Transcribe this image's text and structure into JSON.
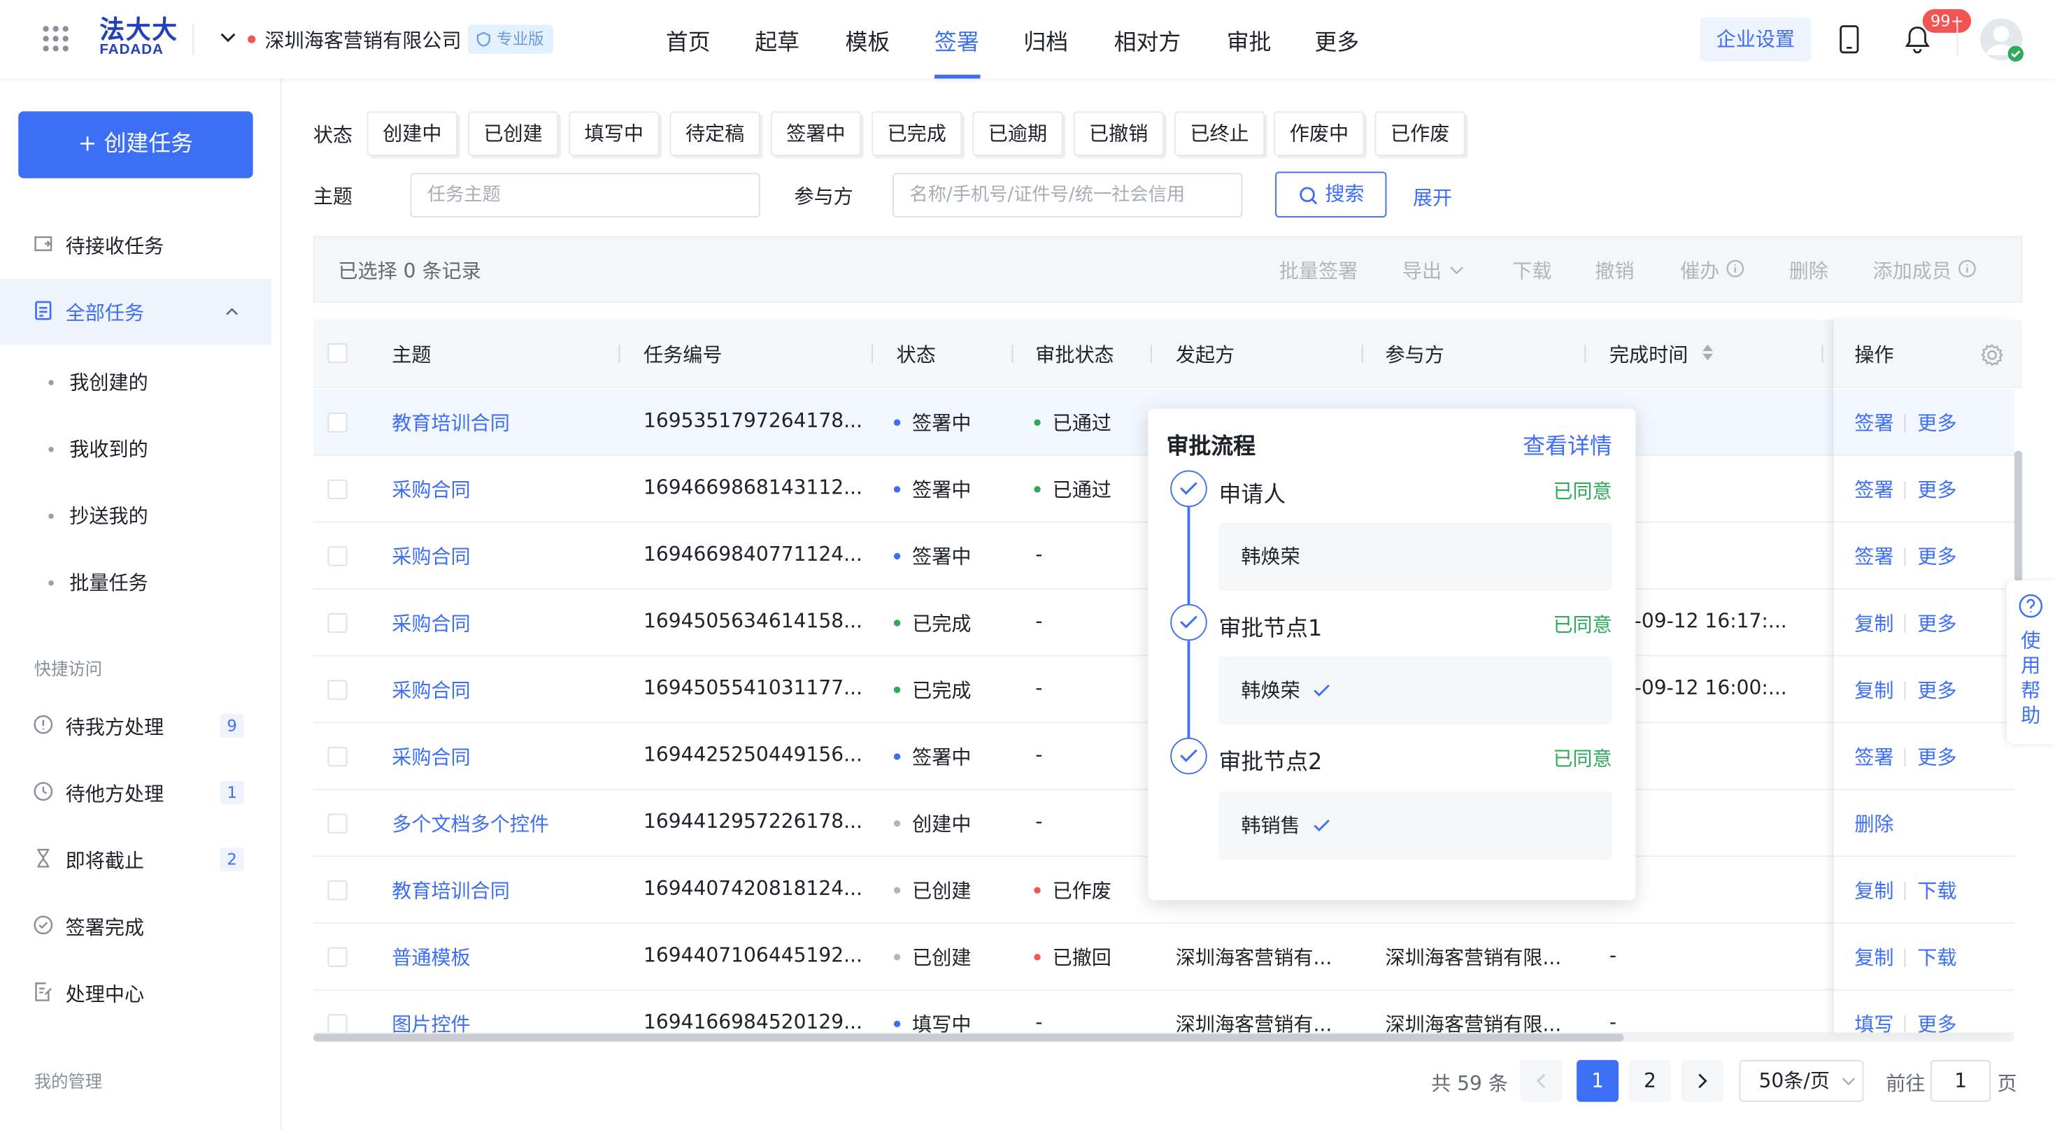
{
  "brand": {
    "logo_main": "法大大",
    "logo_sub": "FADADA"
  },
  "header": {
    "company": "深圳海客营销有限公司",
    "edition": "专业版",
    "nav": [
      "首页",
      "起草",
      "模板",
      "签署",
      "归档",
      "相对方",
      "审批",
      "更多"
    ],
    "active_nav": "签署",
    "enterprise_settings": "企业设置",
    "notification_count": "99+"
  },
  "sidebar": {
    "create_button": "+ 创建任务",
    "pending": "待接收任务",
    "all_tasks": "全部任务",
    "sub_items": [
      "我创建的",
      "我收到的",
      "抄送我的",
      "批量任务"
    ],
    "quick_access_title": "快捷访问",
    "quick": [
      {
        "label": "待我方处理",
        "count": "9"
      },
      {
        "label": "待他方处理",
        "count": "1"
      },
      {
        "label": "即将截止",
        "count": "2"
      },
      {
        "label": "签署完成",
        "count": ""
      },
      {
        "label": "处理中心",
        "count": ""
      }
    ],
    "management_title": "我的管理"
  },
  "filters": {
    "status_label": "状态",
    "statuses": [
      "创建中",
      "已创建",
      "填写中",
      "待定稿",
      "签署中",
      "已完成",
      "已逾期",
      "已撤销",
      "已终止",
      "作废中",
      "已作废"
    ],
    "subject_label": "主题",
    "subject_placeholder": "任务主题",
    "party_label": "参与方",
    "party_placeholder": "名称/手机号/证件号/统一社会信用",
    "search": "搜索",
    "expand": "展开"
  },
  "batch": {
    "selected": "已选择 0 条记录",
    "actions": [
      "批量签署",
      "导出",
      "下载",
      "撤销",
      "催办",
      "删除",
      "添加成员"
    ]
  },
  "table": {
    "columns": [
      "主题",
      "任务编号",
      "状态",
      "审批状态",
      "发起方",
      "参与方",
      "完成时间",
      "操作"
    ],
    "rows": [
      {
        "subject": "教育培训合同",
        "id": "1695351797264178...",
        "status": "签署中",
        "status_color": "#3c6ef6",
        "approval": "已通过",
        "approval_color": "#2eaa5a",
        "initiator": "",
        "party": "",
        "done": "",
        "ops": [
          "签署",
          "更多"
        ]
      },
      {
        "subject": "采购合同",
        "id": "1694669868143112...",
        "status": "签署中",
        "status_color": "#3c6ef6",
        "approval": "已通过",
        "approval_color": "#2eaa5a",
        "initiator": "",
        "party": "",
        "done": "",
        "ops": [
          "签署",
          "更多"
        ]
      },
      {
        "subject": "采购合同",
        "id": "1694669840771124...",
        "status": "签署中",
        "status_color": "#3c6ef6",
        "approval": "-",
        "approval_color": "",
        "initiator": "",
        "party": "",
        "done": "",
        "ops": [
          "签署",
          "更多"
        ]
      },
      {
        "subject": "采购合同",
        "id": "1694505634614158...",
        "status": "已完成",
        "status_color": "#2eaa5a",
        "approval": "-",
        "approval_color": "",
        "initiator": "",
        "party": "",
        "done": "23-09-12 16:17:...",
        "ops": [
          "复制",
          "更多"
        ]
      },
      {
        "subject": "采购合同",
        "id": "1694505541031177...",
        "status": "已完成",
        "status_color": "#2eaa5a",
        "approval": "-",
        "approval_color": "",
        "initiator": "",
        "party": "",
        "done": "23-09-12 16:00:...",
        "ops": [
          "复制",
          "更多"
        ]
      },
      {
        "subject": "采购合同",
        "id": "1694425250449156...",
        "status": "签署中",
        "status_color": "#3c6ef6",
        "approval": "-",
        "approval_color": "",
        "initiator": "",
        "party": "",
        "done": "",
        "ops": [
          "签署",
          "更多"
        ]
      },
      {
        "subject": "多个文档多个控件",
        "id": "1694412957226178...",
        "status": "创建中",
        "status_color": "#b1b5bc",
        "approval": "-",
        "approval_color": "",
        "initiator": "",
        "party": "",
        "done": "",
        "ops": [
          "删除"
        ]
      },
      {
        "subject": "教育培训合同",
        "id": "1694407420818124...",
        "status": "已创建",
        "status_color": "#b1b5bc",
        "approval": "已作废",
        "approval_color": "#f25353",
        "initiator": "",
        "party": "",
        "done": "",
        "ops": [
          "复制",
          "下载"
        ]
      },
      {
        "subject": "普通模板",
        "id": "1694407106445192...",
        "status": "已创建",
        "status_color": "#b1b5bc",
        "approval": "已撤回",
        "approval_color": "#f25353",
        "initiator": "深圳海客营销有...",
        "party": "深圳海客营销有限...",
        "done": "-",
        "ops": [
          "复制",
          "下载"
        ]
      },
      {
        "subject": "图片控件",
        "id": "1694166984520129...",
        "status": "填写中",
        "status_color": "#3c6ef6",
        "approval": "-",
        "approval_color": "",
        "initiator": "深圳海客营销有...",
        "party": "深圳海客营销有限...",
        "done": "-",
        "ops": [
          "填写",
          "更多"
        ]
      }
    ]
  },
  "popover": {
    "title": "审批流程",
    "detail_link": "查看详情",
    "steps": [
      {
        "name": "申请人",
        "status": "已同意",
        "person": "韩焕荣",
        "check": false
      },
      {
        "name": "审批节点1",
        "status": "已同意",
        "person": "韩焕荣",
        "check": true
      },
      {
        "name": "审批节点2",
        "status": "已同意",
        "person": "韩销售",
        "check": true
      }
    ]
  },
  "help": {
    "label": "使用帮助"
  },
  "pagination": {
    "total": "共 59 条",
    "pages": [
      "1",
      "2"
    ],
    "current": "1",
    "page_size": "50条/页",
    "goto_label": "前往",
    "goto_value": "1",
    "page_suffix": "页"
  },
  "colors": {
    "accent": "#3c6ef6",
    "success": "#2eaa5a",
    "danger": "#f25353",
    "muted": "#b1b5bc"
  }
}
